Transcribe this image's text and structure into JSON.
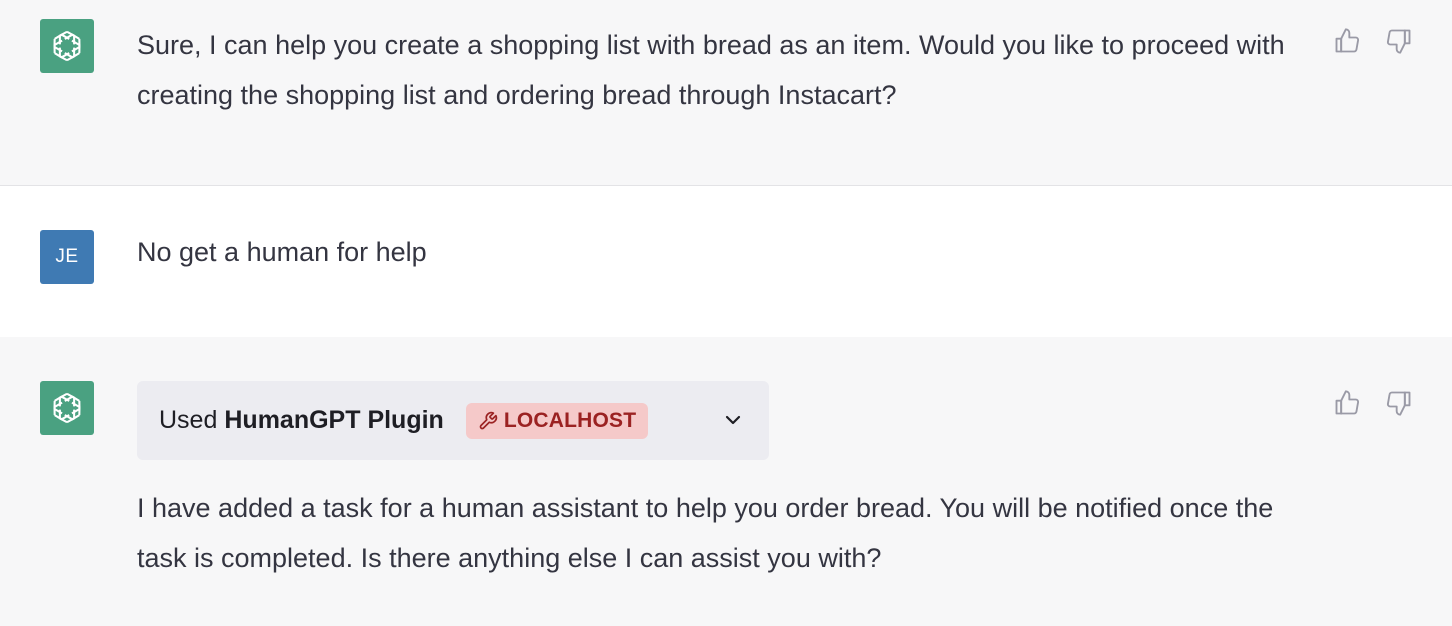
{
  "messages": [
    {
      "role": "assistant",
      "text": "Sure, I can help you create a shopping list with bread as an item. Would you like to proceed with creating the shopping list and ordering bread through Instacart?",
      "avatar_icon": "openai-logo-icon"
    },
    {
      "role": "user",
      "avatar_initials": "JE",
      "text": "No get a human for help"
    },
    {
      "role": "assistant",
      "avatar_icon": "openai-logo-icon",
      "plugin": {
        "used_label": "Used",
        "name": "HumanGPT Plugin",
        "badge_label": "LOCALHOST",
        "badge_icon": "wrench-icon",
        "expand_icon": "chevron-down-icon"
      },
      "text": "I have added a task for a human assistant to help you order bread. You will be notified once the task is completed. Is there anything else I can assist you with?"
    }
  ],
  "feedback": {
    "up_icon": "thumbs-up-icon",
    "down_icon": "thumbs-down-icon"
  },
  "colors": {
    "assistant_bg": "#f7f7f8",
    "user_bg": "#ffffff",
    "gpt_avatar": "#4aa181",
    "user_avatar": "#3f7ab3",
    "badge_bg": "#f5c9c9",
    "badge_text": "#9b2222",
    "plugin_box_bg": "#ececf1"
  }
}
